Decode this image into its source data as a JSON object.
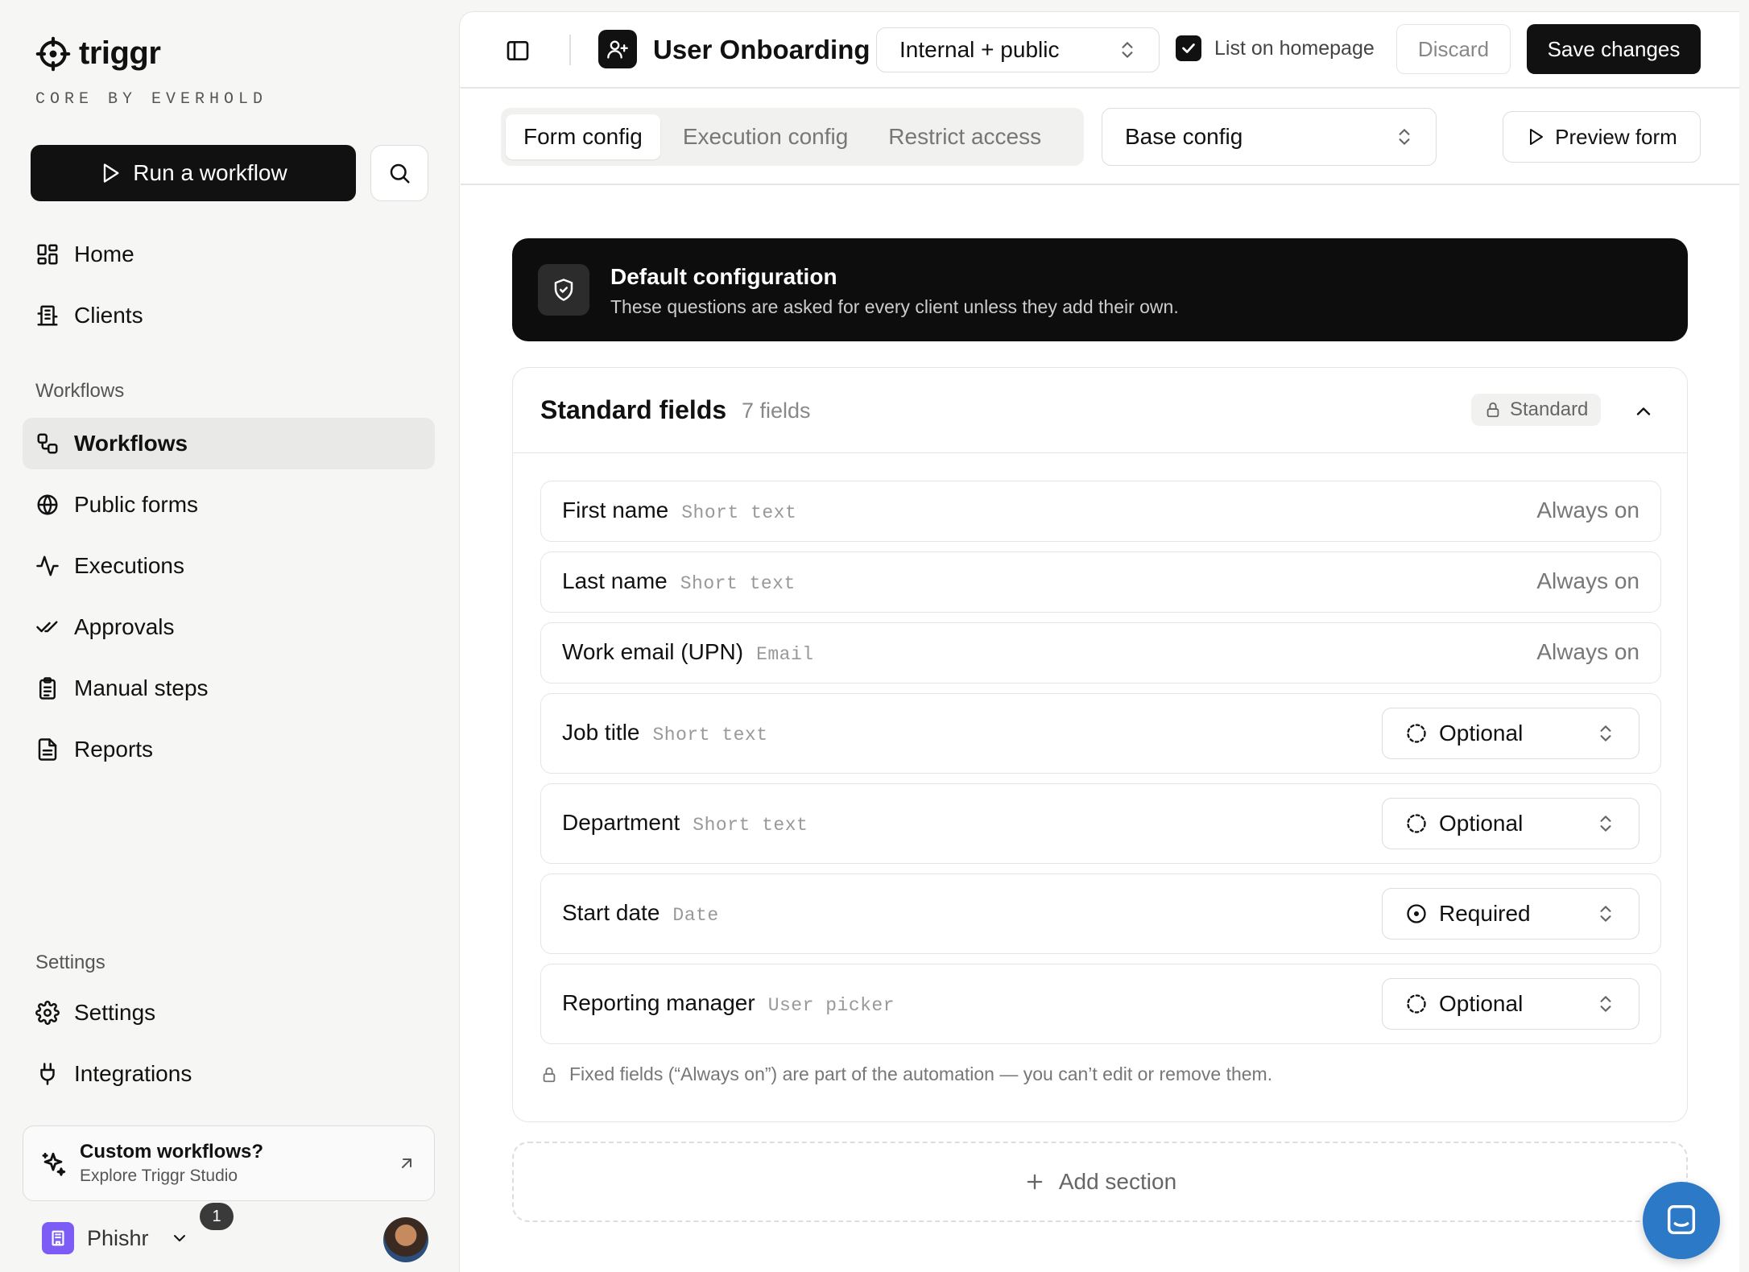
{
  "brand": {
    "name": "triggr",
    "subtitle": "CORE BY EVERHOLD"
  },
  "sidebar": {
    "run_button": "Run a workflow",
    "top_items": [
      {
        "label": "Home",
        "icon": "layout-grid-icon"
      },
      {
        "label": "Clients",
        "icon": "building-icon"
      }
    ],
    "workflows_section": "Workflows",
    "workflow_items": [
      {
        "label": "Workflows",
        "icon": "workflow-icon",
        "active": true
      },
      {
        "label": "Public forms",
        "icon": "globe-icon"
      },
      {
        "label": "Executions",
        "icon": "activity-icon"
      },
      {
        "label": "Approvals",
        "icon": "check-check-icon"
      },
      {
        "label": "Manual steps",
        "icon": "clipboard-list-icon"
      },
      {
        "label": "Reports",
        "icon": "file-text-icon"
      }
    ],
    "settings_section": "Settings",
    "settings_items": [
      {
        "label": "Settings",
        "icon": "gear-icon"
      },
      {
        "label": "Integrations",
        "icon": "plug-icon"
      }
    ],
    "promo": {
      "title": "Custom workflows?",
      "subtitle": "Explore Triggr Studio"
    },
    "workspace": {
      "name": "Phishr",
      "notification_count": "1"
    }
  },
  "topbar": {
    "title": "User Onboarding",
    "visibility": "Internal + public",
    "list_on_homepage": "List on homepage",
    "discard": "Discard",
    "save": "Save changes"
  },
  "subbar": {
    "tabs": [
      "Form config",
      "Execution config",
      "Restrict access"
    ],
    "active_tab": "Form config",
    "config_select": "Base config",
    "preview": "Preview form"
  },
  "banner": {
    "title": "Default configuration",
    "subtitle": "These questions are asked for every client unless they add their own."
  },
  "standard_fields": {
    "title": "Standard fields",
    "count": "7 fields",
    "pill": "Standard",
    "rows": [
      {
        "label": "First name",
        "type": "Short text",
        "state": "Always on"
      },
      {
        "label": "Last name",
        "type": "Short text",
        "state": "Always on"
      },
      {
        "label": "Work email (UPN)",
        "type": "Email",
        "state": "Always on"
      },
      {
        "label": "Job title",
        "type": "Short text",
        "select": "Optional"
      },
      {
        "label": "Department",
        "type": "Short text",
        "select": "Optional"
      },
      {
        "label": "Start date",
        "type": "Date",
        "select": "Required"
      },
      {
        "label": "Reporting manager",
        "type": "User picker",
        "select": "Optional"
      }
    ],
    "note": "Fixed fields (“Always on”) are part of the automation — you can’t edit or remove them."
  },
  "add_section": "Add section",
  "colors": {
    "accent": "#111111",
    "workspace": "#7c5cf4",
    "chat": "#2c79c8"
  }
}
